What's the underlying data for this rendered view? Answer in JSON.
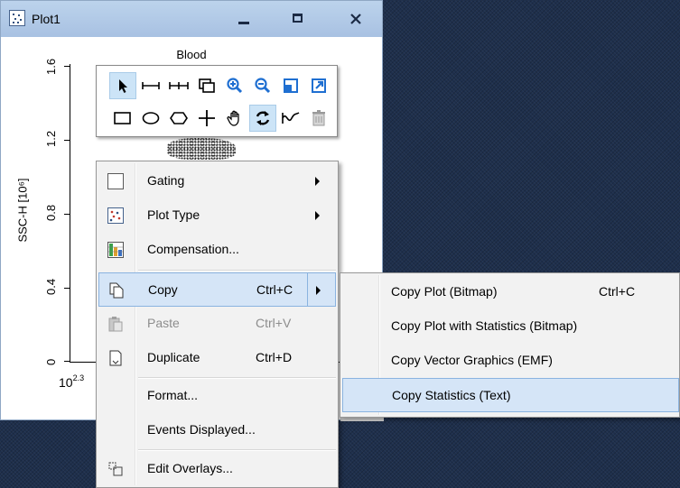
{
  "window": {
    "title": "Plot1",
    "minimize_label": "Minimize",
    "maximize_label": "Maximize",
    "close_label": "Close"
  },
  "plot": {
    "title": "Blood",
    "y_axis_label": "SSC-H [10⁶]",
    "y_ticks": [
      "1.6",
      "1.2",
      "0.8",
      "0.4",
      "0"
    ],
    "x_tick_base": "10",
    "x_tick_exp": "2.3"
  },
  "toolbar": {
    "row1": [
      "pointer-icon",
      "range-gate-icon",
      "bi-range-gate-icon",
      "copy-gate-icon",
      "zoom-in-icon",
      "zoom-out-icon",
      "shrink-axis-icon",
      "expand-axis-icon"
    ],
    "row2": [
      "rectangle-gate-icon",
      "ellipse-gate-icon",
      "polygon-gate-icon",
      "quadrant-gate-icon",
      "pan-hand-icon",
      "rotate-icon",
      "spline-gate-icon",
      "delete-gate-icon"
    ],
    "active": [
      "pointer-icon",
      "rotate-icon"
    ]
  },
  "context_menu": {
    "items": [
      {
        "label": "Gating",
        "shortcut": "",
        "submenu": true
      },
      {
        "label": "Plot Type",
        "shortcut": "",
        "submenu": true
      },
      {
        "label": "Compensation...",
        "shortcut": "",
        "submenu": false
      },
      {
        "label": "Copy",
        "shortcut": "Ctrl+C",
        "submenu": true,
        "highlighted": true
      },
      {
        "label": "Paste",
        "shortcut": "Ctrl+V",
        "submenu": false,
        "disabled": true
      },
      {
        "label": "Duplicate",
        "shortcut": "Ctrl+D",
        "submenu": false
      },
      {
        "label": "Format...",
        "shortcut": "",
        "submenu": false
      },
      {
        "label": "Events Displayed...",
        "shortcut": "",
        "submenu": false
      },
      {
        "label": "Edit Overlays...",
        "shortcut": "",
        "submenu": false
      }
    ]
  },
  "copy_submenu": {
    "items": [
      {
        "label": "Copy Plot (Bitmap)",
        "shortcut": "Ctrl+C"
      },
      {
        "label": "Copy Plot with Statistics (Bitmap)",
        "shortcut": ""
      },
      {
        "label": "Copy Vector Graphics (EMF)",
        "shortcut": ""
      },
      {
        "label": "Copy Statistics (Text)",
        "shortcut": "",
        "highlighted": true
      }
    ]
  },
  "colors": {
    "desktop": "#1e2f4c",
    "titlebar": "#b3cbe7",
    "menu_bg": "#f2f2f2",
    "highlight": "#d5e5f7",
    "highlight_border": "#8ab3e0",
    "tool_active": "#cce4f7"
  }
}
